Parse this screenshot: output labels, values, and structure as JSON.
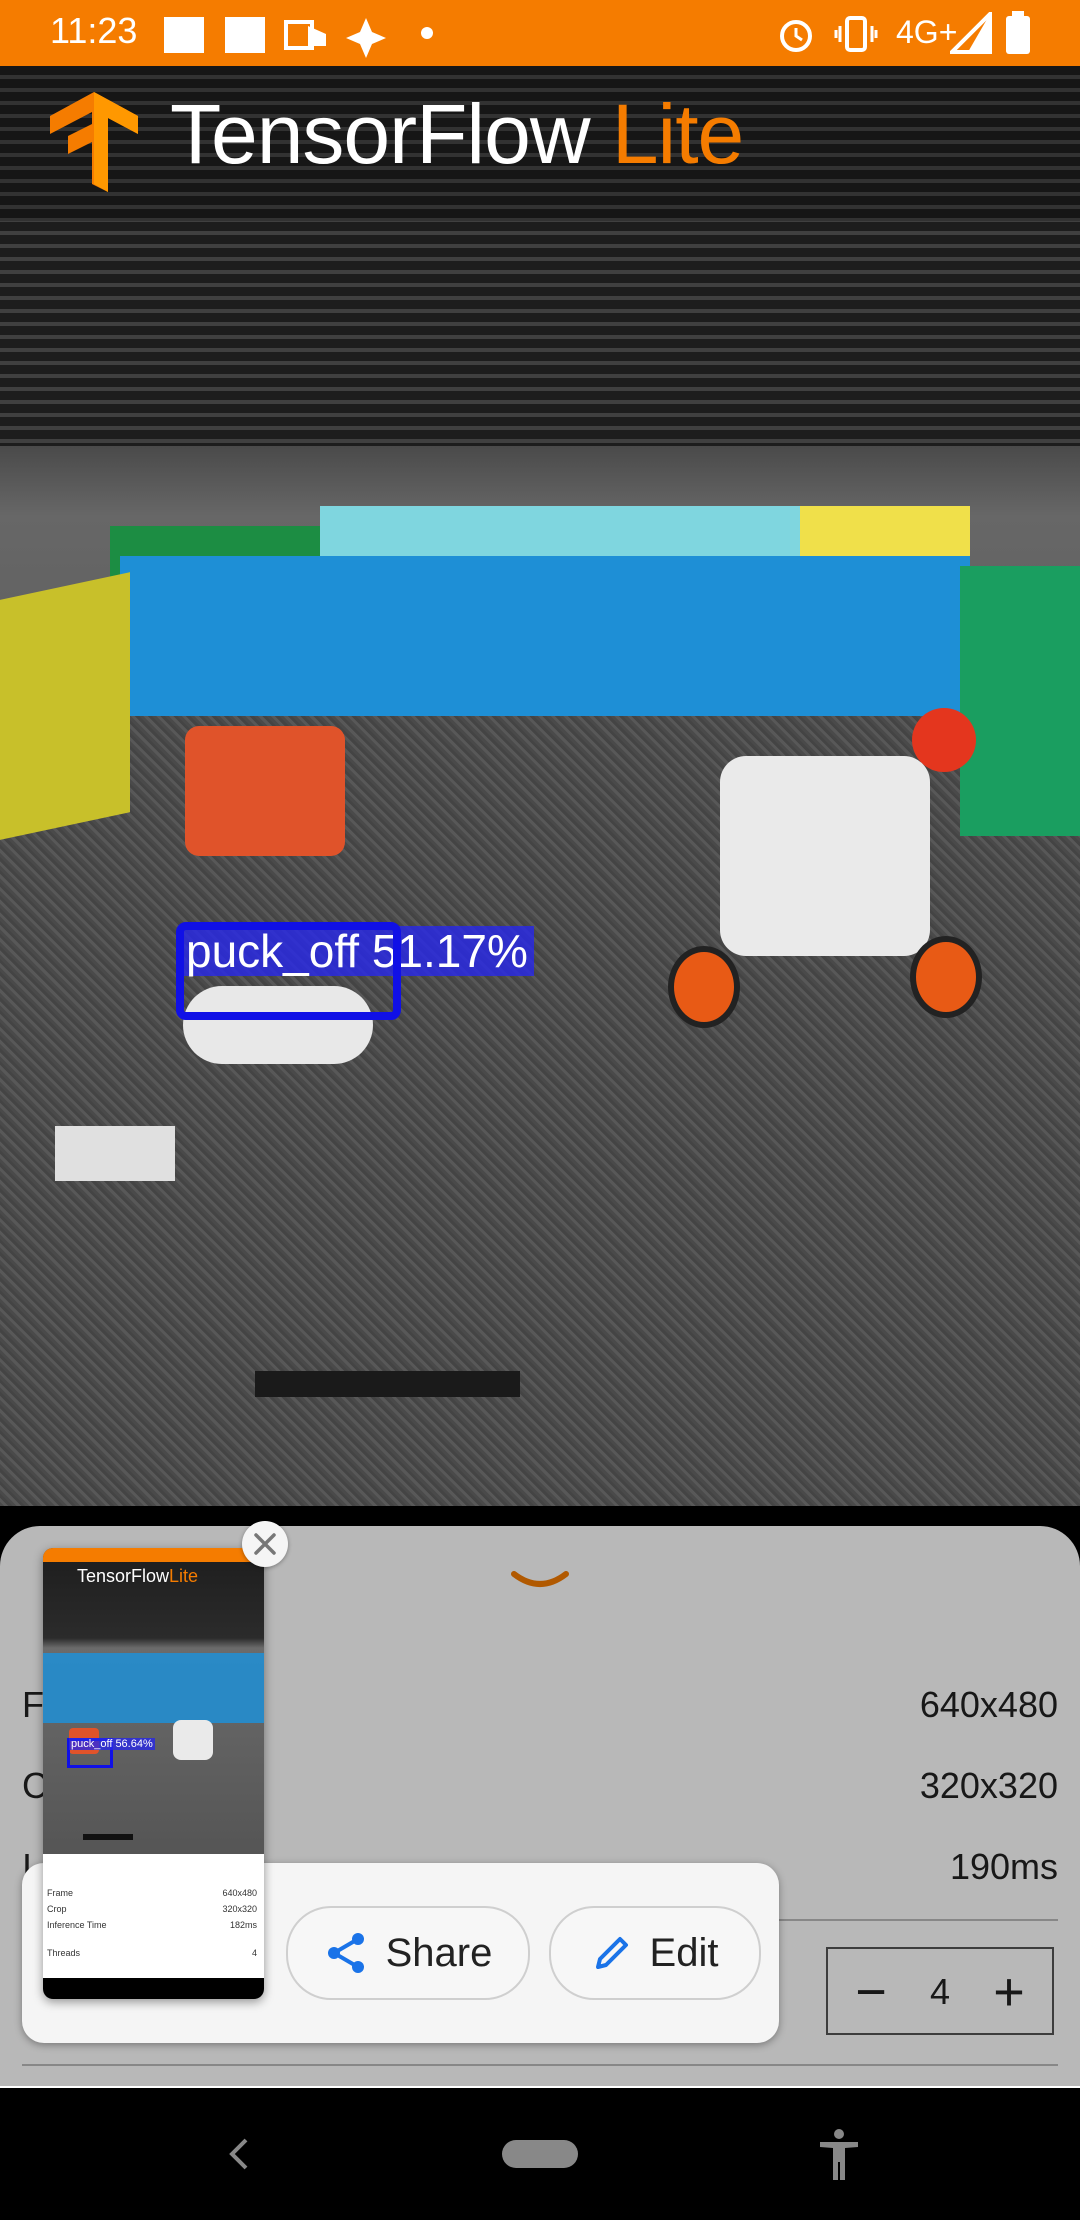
{
  "status_bar": {
    "time": "11:23",
    "network": "4G+",
    "accent_color": "#f57c00",
    "icons": [
      "notification-square-icon",
      "notification-square-icon",
      "outlook-icon",
      "pinwheel-icon",
      "dot-icon",
      "alarm-icon",
      "vibrate-icon",
      "signal-icon",
      "battery-icon"
    ]
  },
  "app": {
    "logo_main": "TensorFlow",
    "logo_accent": "Lite",
    "brand_color": "#f57c00"
  },
  "detection": {
    "label": "puck_off 51.17%",
    "box_color": "#1010e6"
  },
  "bottom_sheet": {
    "rows": [
      {
        "label": "F",
        "value": "640x480"
      },
      {
        "label": "C",
        "value": "320x320"
      },
      {
        "label": "I",
        "value": "190ms"
      }
    ],
    "threads_value": "4"
  },
  "screenshot_popup": {
    "share_label": "Share",
    "edit_label": "Edit",
    "thumbnail": {
      "logo_main": "TensorFlow",
      "logo_accent": "Lite",
      "detection_label": "puck_off 56.64%",
      "rows": [
        {
          "label": "Frame",
          "value": "640x480"
        },
        {
          "label": "Crop",
          "value": "320x320"
        },
        {
          "label": "Inference Time",
          "value": "182ms"
        },
        {
          "label": "Threads",
          "value": "4"
        }
      ]
    }
  }
}
